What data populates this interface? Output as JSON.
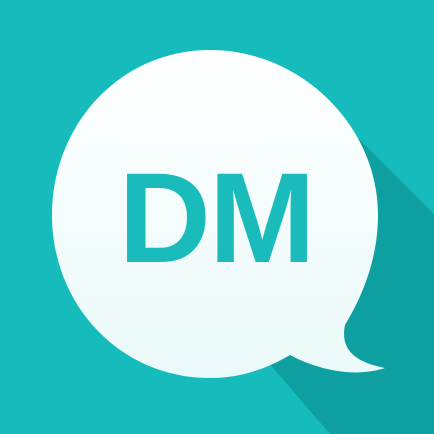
{
  "icon": {
    "logo_text": "DM"
  },
  "colors": {
    "background": "#16bcbc",
    "shadow": "#0e9fa0",
    "bubble": "#f1fcfc",
    "text": "#19bcbb"
  }
}
